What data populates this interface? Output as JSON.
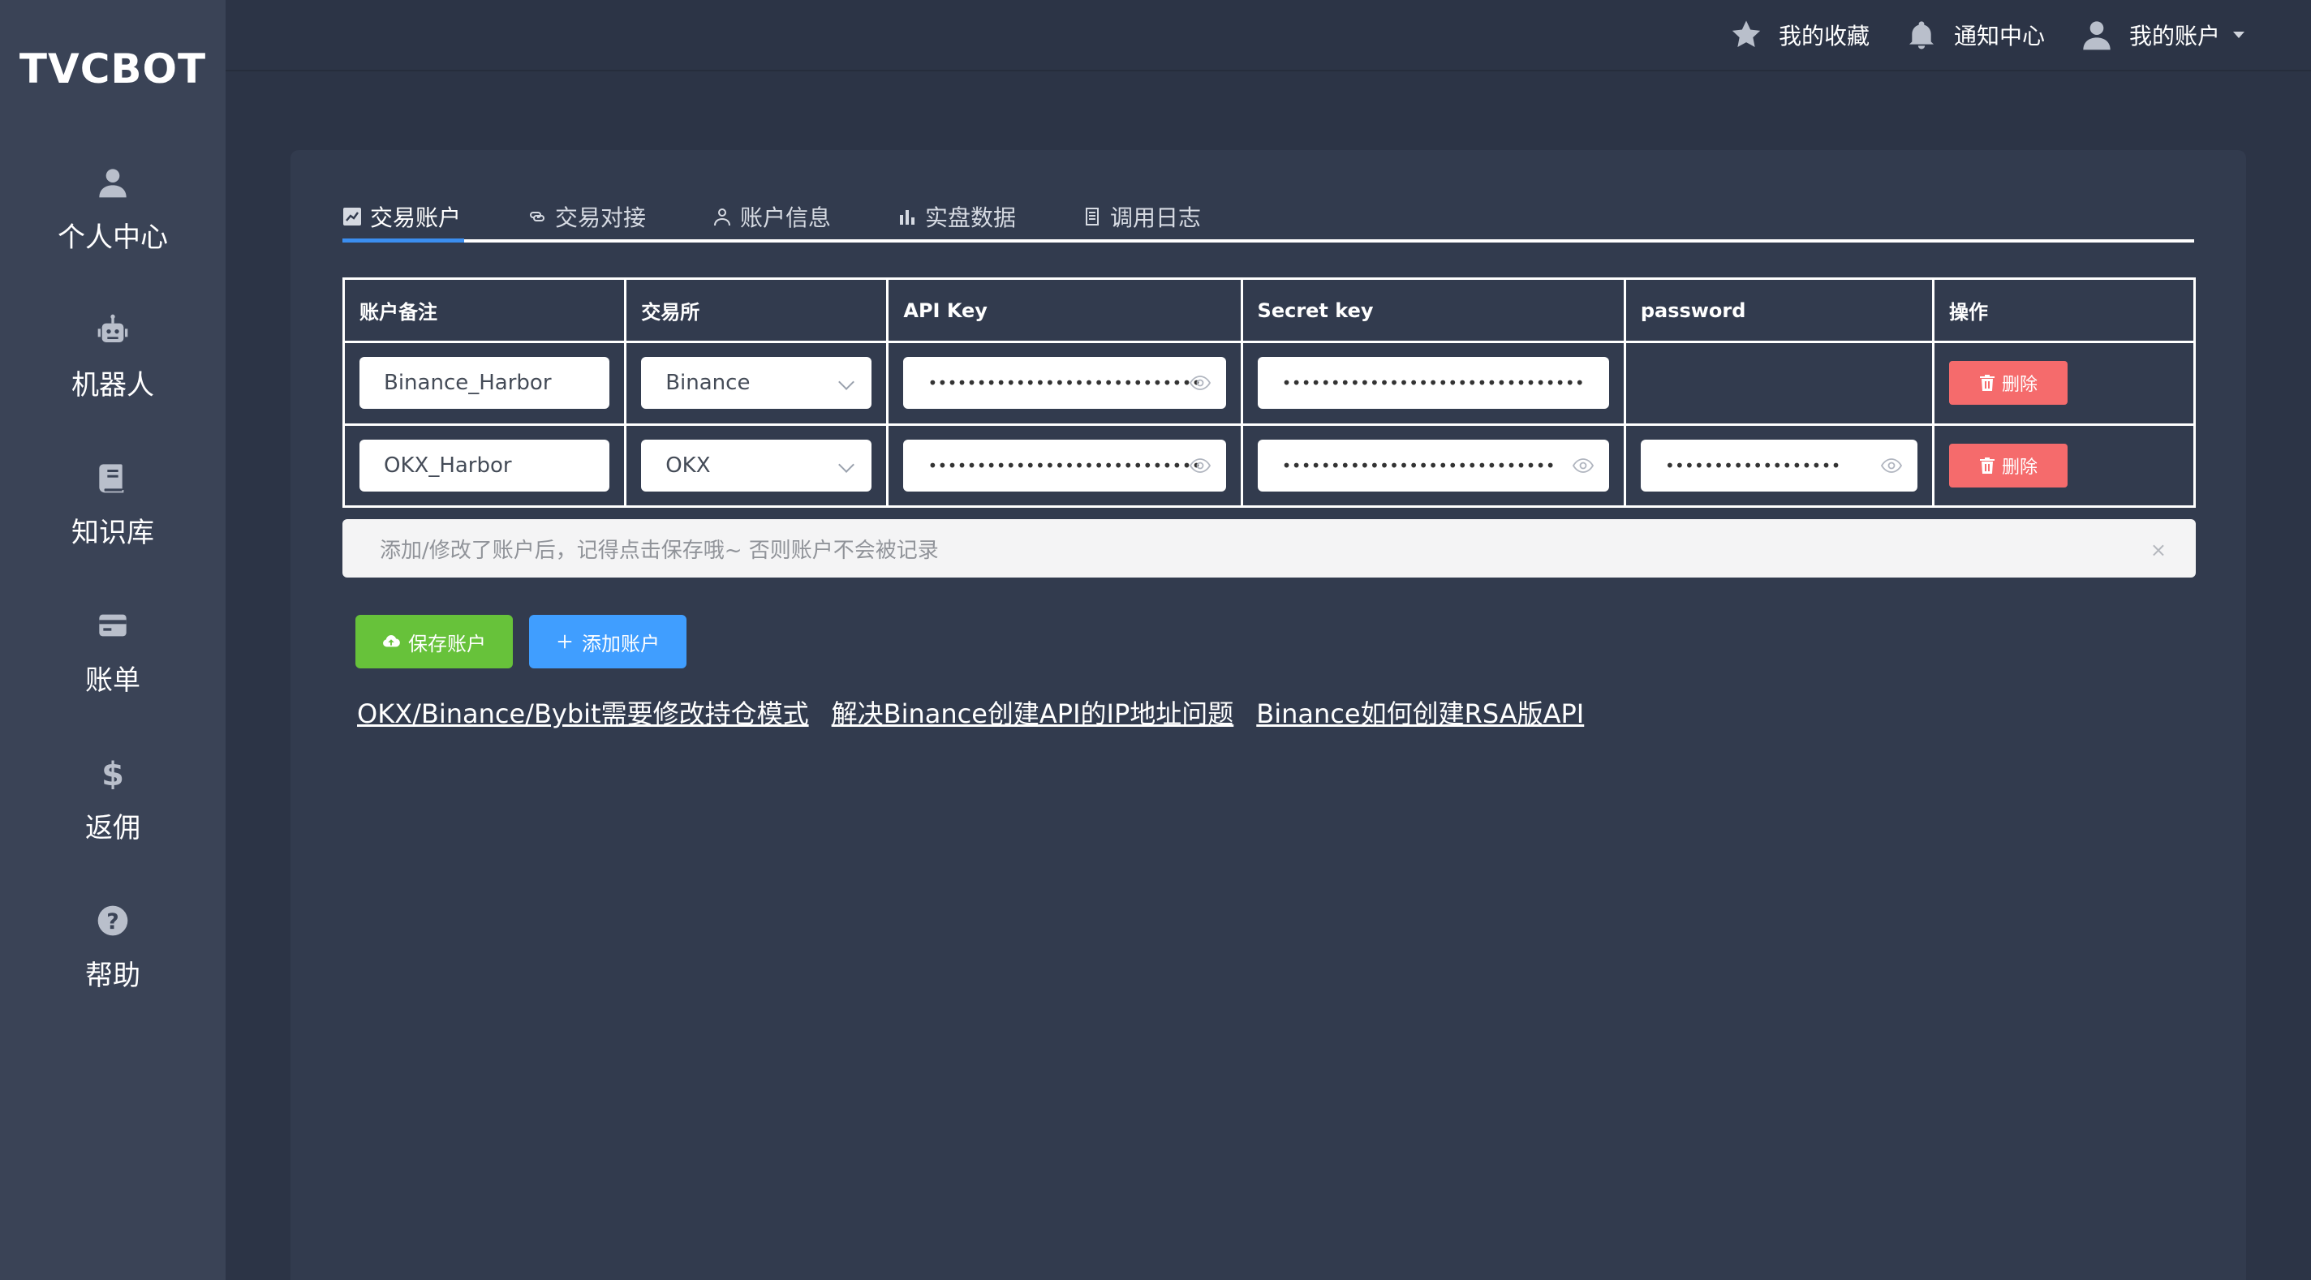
{
  "app": {
    "logo": "TVCBOT"
  },
  "sidebar": {
    "items": [
      {
        "label": "个人中心",
        "icon": "user-icon"
      },
      {
        "label": "机器人",
        "icon": "robot-icon"
      },
      {
        "label": "知识库",
        "icon": "book-icon"
      },
      {
        "label": "账单",
        "icon": "card-icon"
      },
      {
        "label": "返佣",
        "icon": "dollar-icon"
      },
      {
        "label": "帮助",
        "icon": "question-icon"
      }
    ]
  },
  "header": {
    "favorites": "我的收藏",
    "notifications": "通知中心",
    "account": "我的账户"
  },
  "tabs": [
    {
      "label": "交易账户",
      "active": true
    },
    {
      "label": "交易对接"
    },
    {
      "label": "账户信息"
    },
    {
      "label": "实盘数据"
    },
    {
      "label": "调用日志"
    }
  ],
  "table": {
    "columns": [
      "账户备注",
      "交易所",
      "API Key",
      "Secret key",
      "password",
      "操作"
    ],
    "rows": [
      {
        "note": "Binance_Harbor",
        "exchange": "Binance",
        "api_key": "••••••••••••••••••••••••••••",
        "secret_key": "•••••••••••••••••••••••••••••••",
        "password": "",
        "action": "删除"
      },
      {
        "note": "OKX_Harbor",
        "exchange": "OKX",
        "api_key": "••••••••••••••••••••••••••••",
        "secret_key": "••••••••••••••••••••••••••••",
        "password": "••••••••••••••••••",
        "action": "删除"
      }
    ]
  },
  "alert": {
    "text": "添加/修改了账户后，记得点击保存哦~ 否则账户不会被记录",
    "close": "×"
  },
  "buttons": {
    "save": "保存账户",
    "add": "添加账户"
  },
  "links": [
    "OKX/Binance/Bybit需要修改持仓模式",
    "解决Binance创建API的IP地址问题",
    "Binance如何创建RSA版API"
  ],
  "colors": {
    "background": "#2c3446",
    "sidebar": "#3a4356",
    "card": "#323b4e",
    "save": "#67c23a",
    "add": "#409eff",
    "delete": "#f56b6c",
    "tab_active": "#3b8ef0"
  }
}
